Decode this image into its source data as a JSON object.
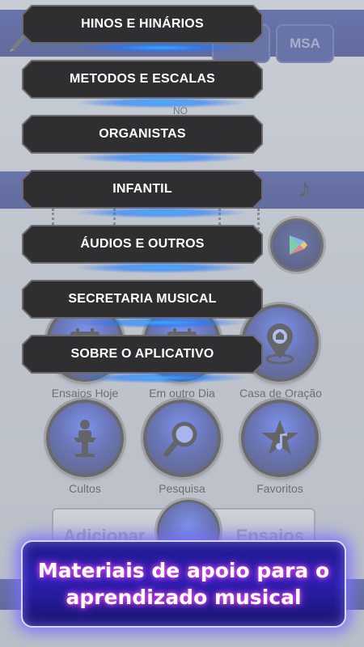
{
  "background": {
    "top_button_label": "MSA",
    "no_label": "NO",
    "grid": [
      {
        "label": "Ensaios Hoje",
        "icon": "calendar-icon"
      },
      {
        "label": "Em outro Dia",
        "icon": "calendar-icon"
      },
      {
        "label": "Casa de Oração",
        "icon": "map-pin-icon"
      },
      {
        "label": "Cultos",
        "icon": "pulpit-icon"
      },
      {
        "label": "Pesquisa",
        "icon": "magnifier-icon"
      },
      {
        "label": "Favoritos",
        "icon": "star-music-icon"
      }
    ],
    "add_bar": {
      "left": "Adicionar",
      "right": "Ensaios"
    }
  },
  "menu": {
    "items": [
      {
        "label": "HINOS E HINÁRIOS"
      },
      {
        "label": "METODOS E ESCALAS"
      },
      {
        "label": "ORGANISTAS"
      },
      {
        "label": "INFANTIL"
      },
      {
        "label": "ÁUDIOS E OUTROS"
      },
      {
        "label": "SECRETARIA MUSICAL"
      },
      {
        "label": "SOBRE O APLICATIVO"
      }
    ]
  },
  "banner": {
    "line1": "Materiais de apoio para o",
    "line2": "aprendizado musical"
  },
  "colors": {
    "menu_fill": "#2f2f31",
    "menu_glow": "#3aa8ff",
    "banner_bg": "#2a1fb0",
    "banner_glow": "#8e7bff",
    "app_blue": "#1c2c8a"
  }
}
